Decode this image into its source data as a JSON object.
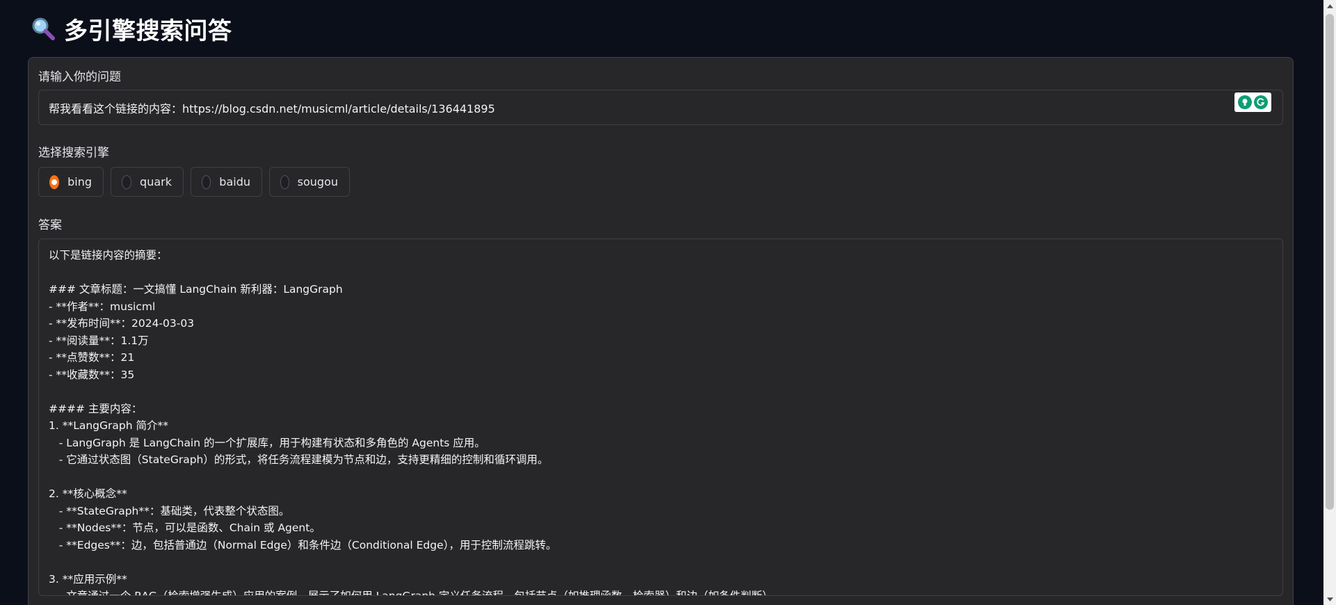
{
  "app": {
    "title": "多引擎搜索问答",
    "title_icon": "magnifier-icon"
  },
  "question": {
    "label": "请输入你的问题",
    "value": "帮我看看这个链接的内容：https://blog.csdn.net/musicml/article/details/136441895",
    "extension_icons": [
      "lightbulb-icon",
      "grammarly-icon"
    ]
  },
  "engine": {
    "label": "选择搜索引擎",
    "options": [
      {
        "label": "bing",
        "checked": true
      },
      {
        "label": "quark",
        "checked": false
      },
      {
        "label": "baidu",
        "checked": false
      },
      {
        "label": "sougou",
        "checked": false
      }
    ]
  },
  "answer": {
    "label": "答案",
    "lines": [
      "以下是链接内容的摘要：",
      "",
      "### 文章标题：一文搞懂 LangChain 新利器：LangGraph",
      "- **作者**：musicml",
      "- **发布时间**：2024-03-03",
      "- **阅读量**：1.1万",
      "- **点赞数**：21",
      "- **收藏数**：35",
      "",
      "#### 主要内容：",
      "1. **LangGraph 简介**",
      "   - LangGraph 是 LangChain 的一个扩展库，用于构建有状态和多角色的 Agents 应用。",
      "   - 它通过状态图（StateGraph）的形式，将任务流程建模为节点和边，支持更精细的控制和循环调用。",
      "",
      "2. **核心概念**",
      "   - **StateGraph**：基础类，代表整个状态图。",
      "   - **Nodes**：节点，可以是函数、Chain 或 Agent。",
      "   - **Edges**：边，包括普通边（Normal Edge）和条件边（Conditional Edge），用于控制流程跳转。",
      "",
      "3. **应用示例**",
      "   - 文章通过一个 RAG（检索增强生成）应用的案例，展示了如何用 LangGraph 定义任务流程，包括节点（如推理函数、检索器）和边（如条件判断）。"
    ]
  },
  "colors": {
    "background": "#0b0f19",
    "panel": "#27272a",
    "border": "#3f3f46",
    "accent": "#f97316"
  }
}
